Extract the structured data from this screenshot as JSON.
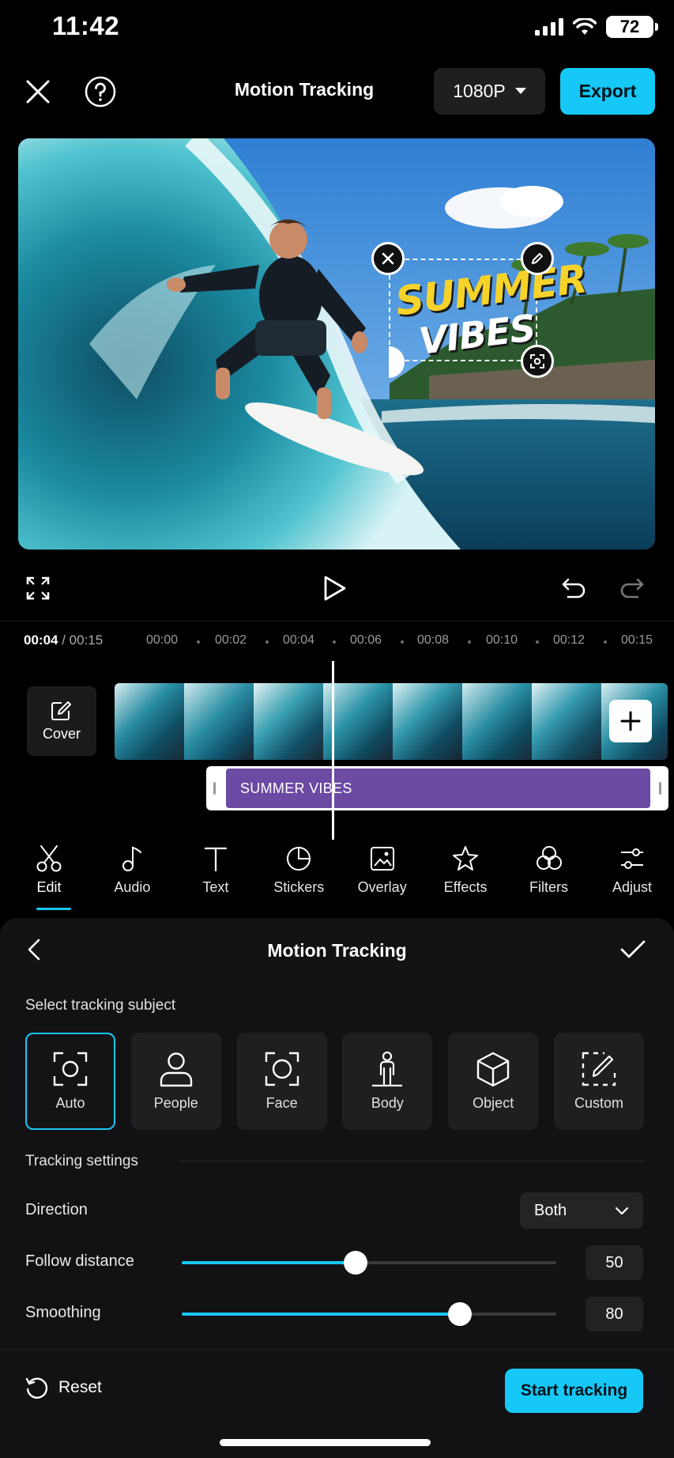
{
  "status_bar": {
    "time": "11:42",
    "battery": "72"
  },
  "top_bar": {
    "title": "Motion Tracking",
    "resolution": "1080P",
    "export_label": "Export"
  },
  "preview": {
    "overlay_line1": "SUMMER",
    "overlay_line2": "VIBES"
  },
  "player": {
    "current_time": "00:04",
    "duration": "/ 00:15",
    "ticks": [
      "00:00",
      "00:02",
      "00:04",
      "00:06",
      "00:08",
      "00:10",
      "00:12",
      "00:15"
    ]
  },
  "timeline": {
    "cover_label": "Cover",
    "text_clip_label": "SUMMER VIBES"
  },
  "tools": [
    {
      "label": "Edit",
      "icon": "scissors-icon"
    },
    {
      "label": "Audio",
      "icon": "music-note-icon"
    },
    {
      "label": "Text",
      "icon": "text-icon"
    },
    {
      "label": "Stickers",
      "icon": "sticker-icon"
    },
    {
      "label": "Overlay",
      "icon": "overlay-icon"
    },
    {
      "label": "Effects",
      "icon": "effects-star-icon"
    },
    {
      "label": "Filters",
      "icon": "filters-icon"
    },
    {
      "label": "Adjust",
      "icon": "adjust-sliders-icon"
    }
  ],
  "sheet": {
    "title": "Motion Tracking",
    "subject_label": "Select tracking subject",
    "subjects": [
      {
        "label": "Auto",
        "icon": "auto-focus-icon"
      },
      {
        "label": "People",
        "icon": "person-icon"
      },
      {
        "label": "Face",
        "icon": "face-frame-icon"
      },
      {
        "label": "Body",
        "icon": "body-icon"
      },
      {
        "label": "Object",
        "icon": "cube-icon"
      },
      {
        "label": "Custom",
        "icon": "custom-edit-icon"
      }
    ],
    "settings_label": "Tracking settings",
    "direction_label": "Direction",
    "direction_value": "Both",
    "follow_label": "Follow distance",
    "follow_value": "50",
    "smoothing_label": "Smoothing",
    "smoothing_value": "80",
    "reset_label": "Reset",
    "start_label": "Start tracking"
  },
  "colors": {
    "accent": "#16c8f5",
    "text_clip": "#6b4aa4"
  }
}
